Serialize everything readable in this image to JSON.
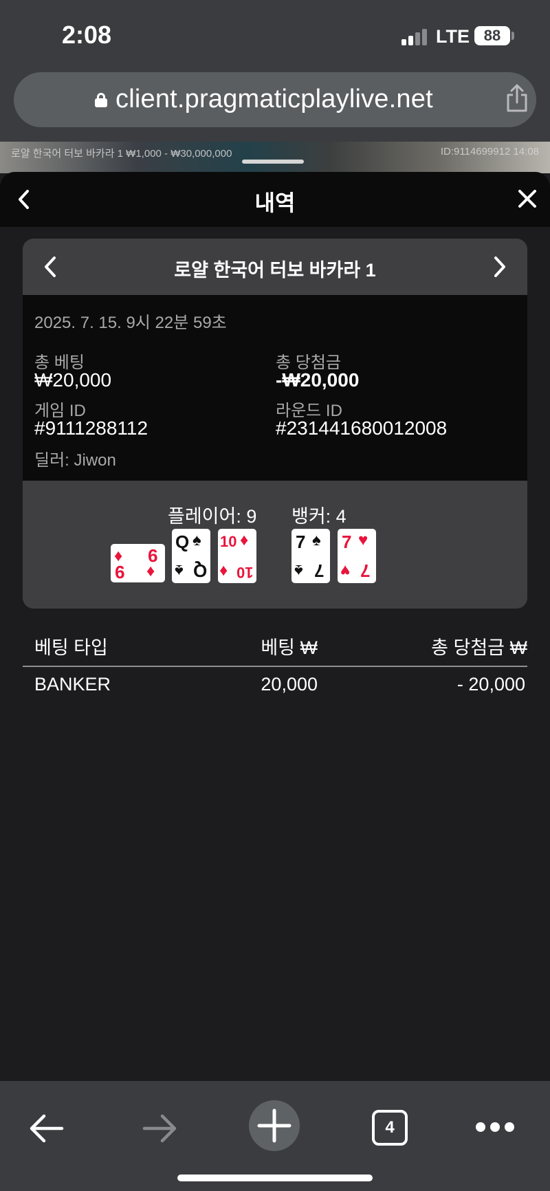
{
  "status_bar": {
    "time": "2:08",
    "network": "LTE",
    "battery": "88"
  },
  "browser": {
    "url": "client.pragmaticplaylive.net"
  },
  "background_game": {
    "info": "로얄 한국어 터보 바카라 1  ₩1,000 - ₩30,000,000",
    "id_time": "ID:9114699912  14:08"
  },
  "sheet": {
    "title": "내역"
  },
  "round": {
    "table_name": "로얄 한국어 터보 바카라 1",
    "datetime": "2025. 7. 15. 9시 22분 59초",
    "total_bet_label": "총 베팅",
    "total_bet": "₩20,000",
    "total_win_label": "총 당첨금",
    "total_win": "-₩20,000",
    "game_id_label": "게임 ID",
    "game_id": "#9111288112",
    "round_id_label": "라운드 ID",
    "round_id": "#231441680012008",
    "dealer": "딜러: Jiwon"
  },
  "hands": {
    "player_score": "플레이어: 9",
    "banker_score": "뱅커: 4",
    "player_cards": [
      {
        "rank": "9",
        "suit": "♦",
        "color": "red",
        "orientation": "sideways"
      },
      {
        "rank": "Q",
        "suit": "♠",
        "color": "black",
        "orientation": "upright"
      },
      {
        "rank": "10",
        "suit": "♦",
        "color": "red",
        "orientation": "upright"
      }
    ],
    "banker_cards": [
      {
        "rank": "7",
        "suit": "♠",
        "color": "black",
        "orientation": "upright"
      },
      {
        "rank": "7",
        "suit": "♥",
        "color": "red",
        "orientation": "upright"
      }
    ]
  },
  "bets_table": {
    "headers": {
      "type": "베팅 타입",
      "bet": "베팅 ₩",
      "win": "총 당첨금 ₩"
    },
    "rows": [
      {
        "type": "BANKER",
        "bet": "20,000",
        "win": "- 20,000"
      }
    ]
  },
  "toolbar": {
    "tab_count": "4"
  },
  "colors": {
    "card_red": "#e8143c",
    "sheet_bg": "#1c1c1e",
    "header_bg": "#0b0b0b",
    "panel_bg": "#3f3f41"
  }
}
